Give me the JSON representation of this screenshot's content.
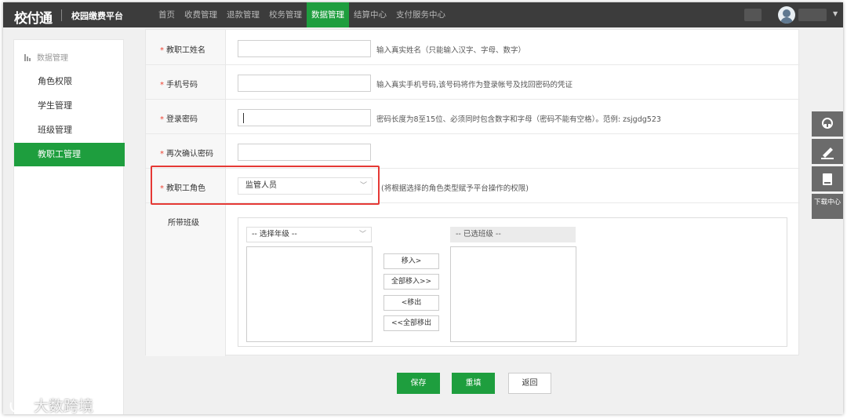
{
  "header": {
    "logo": "校付通",
    "platform": "校园缴费平台",
    "nav": [
      {
        "label": "首页",
        "active": false
      },
      {
        "label": "收费管理",
        "active": false
      },
      {
        "label": "退款管理",
        "active": false
      },
      {
        "label": "校务管理",
        "active": false
      },
      {
        "label": "数据管理",
        "active": true
      },
      {
        "label": "结算中心",
        "active": false
      },
      {
        "label": "支付服务中心",
        "active": false
      }
    ]
  },
  "sidebar": {
    "section": "数据管理",
    "items": [
      {
        "label": "角色权限",
        "active": false
      },
      {
        "label": "学生管理",
        "active": false
      },
      {
        "label": "班级管理",
        "active": false
      },
      {
        "label": "教职工管理",
        "active": true
      }
    ]
  },
  "form": {
    "name": {
      "label": "教职工姓名",
      "value": "",
      "hint": "输入真实姓名（只能输入汉字、字母、数字）"
    },
    "phone": {
      "label": "手机号码",
      "value": "",
      "hint": "输入真实手机号码,该号码将作为登录帐号及找回密码的凭证"
    },
    "password": {
      "label": "登录密码",
      "value": "",
      "hint": "密码长度为8至15位、必须同时包含数字和字母（密码不能有空格）。范例: zsjgdg523"
    },
    "confirm": {
      "label": "再次确认密码",
      "value": ""
    },
    "role": {
      "label": "教职工角色",
      "value": "监管人员",
      "hint": "(将根据选择的角色类型赋予平台操作的权限)"
    },
    "classes": {
      "label": "所带班级",
      "grade_placeholder": "-- 选择年级 --",
      "selected_header": "-- 已选班级 --",
      "move_in": "移入>",
      "move_all_in": "全部移入>>",
      "move_out": "<移出",
      "move_all_out": "<<全部移出"
    }
  },
  "actions": {
    "save": "保存",
    "reset": "重填",
    "back": "返回"
  },
  "tools": {
    "download": "下载中心"
  },
  "watermark": "大数跨境",
  "colors": {
    "accent": "#1e9e3e",
    "highlight": "#e53935",
    "topbar": "#3c3c3c"
  }
}
